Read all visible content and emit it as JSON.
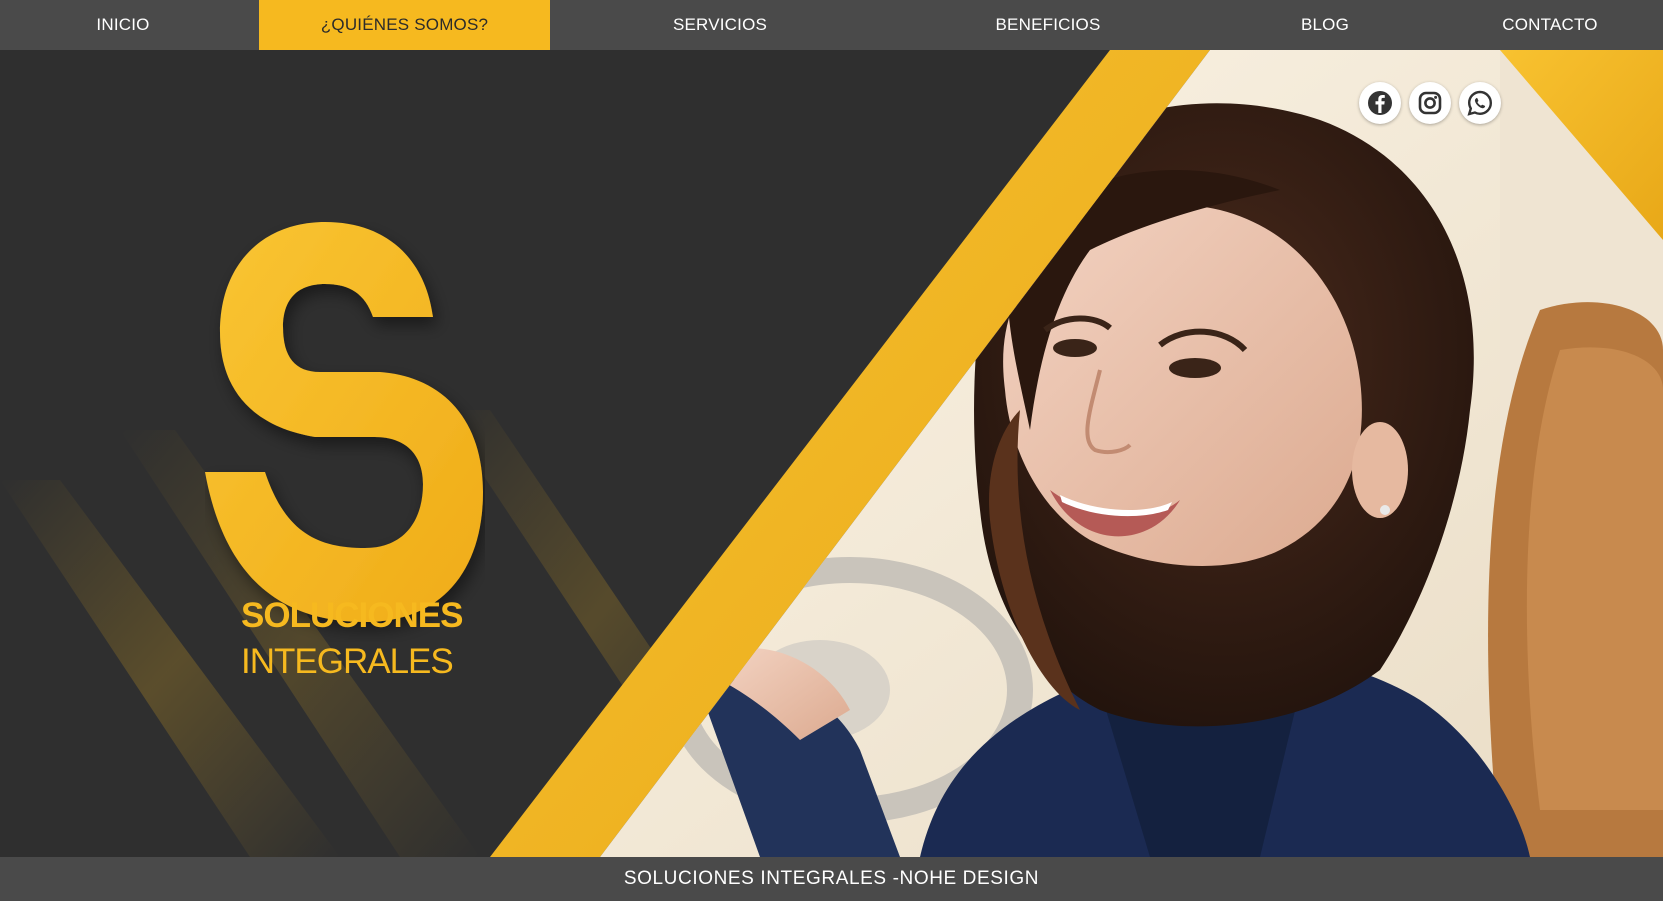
{
  "nav": {
    "items": [
      {
        "label": "INICIO"
      },
      {
        "label": "¿QUIÉNES SOMOS?"
      },
      {
        "label": "SERVICIOS"
      },
      {
        "label": "BENEFICIOS"
      },
      {
        "label": "BLOG"
      },
      {
        "label": "CONTACTO"
      }
    ],
    "active_index": 1
  },
  "hero": {
    "logo": {
      "mark_icon": "s-letter-logo-icon",
      "line1": "SOLUCIONES",
      "line2": "INTEGRALES"
    },
    "social": [
      {
        "icon": "facebook-icon"
      },
      {
        "icon": "instagram-icon"
      },
      {
        "icon": "whatsapp-icon"
      }
    ],
    "photo": "woman-driving-car-photo"
  },
  "footer": {
    "text": "SOLUCIONES INTEGRALES -NOHE DESIGN"
  },
  "colors": {
    "accent": "#f6b91f",
    "nav_bg": "#4a4a4a",
    "hero_bg": "#2e2e2e",
    "text_light": "#ffffff"
  }
}
